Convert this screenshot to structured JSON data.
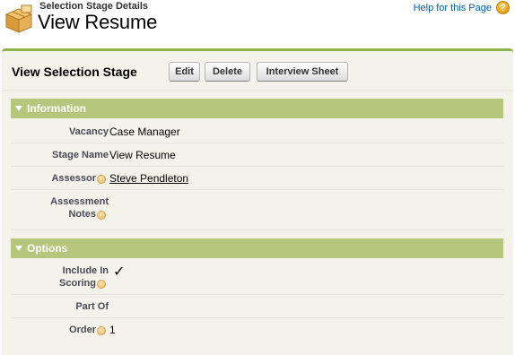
{
  "header": {
    "subtitle": "Selection Stage Details",
    "title": "View Resume",
    "help_link": "Help for this Page",
    "help_icon": "?"
  },
  "detail": {
    "block_title": "View Selection Stage",
    "buttons": {
      "edit": "Edit",
      "delete": "Delete",
      "interview_sheet": "Interview Sheet"
    }
  },
  "sections": {
    "information": {
      "title": "Information",
      "fields": {
        "vacancy": {
          "label": "Vacancy",
          "value": "Case Manager"
        },
        "stage_name": {
          "label": "Stage Name",
          "value": "View Resume"
        },
        "assessor": {
          "label": "Assessor",
          "value": "Steve Pendleton"
        },
        "assessment_notes": {
          "label_line1": "Assessment",
          "label_line2": "Notes",
          "value": ""
        }
      }
    },
    "options": {
      "title": "Options",
      "fields": {
        "include_in_scoring": {
          "label_line1": "Include In",
          "label_line2": "Scoring",
          "value": "✓",
          "checked": true
        },
        "part_of": {
          "label": "Part Of",
          "value": ""
        },
        "order": {
          "label": "Order",
          "value": "1"
        }
      }
    }
  },
  "colors": {
    "accent_border": "#8eb250",
    "section_header": "#b6c77d",
    "link": "#015ba7",
    "panel_bg": "#f3f3ec"
  },
  "icons": {
    "page_icon": "package-boxes-icon",
    "help_icon": "help-circle-icon",
    "hint_icon": "info-bubble-icon",
    "section_toggle_icon": "triangle-down-icon"
  }
}
